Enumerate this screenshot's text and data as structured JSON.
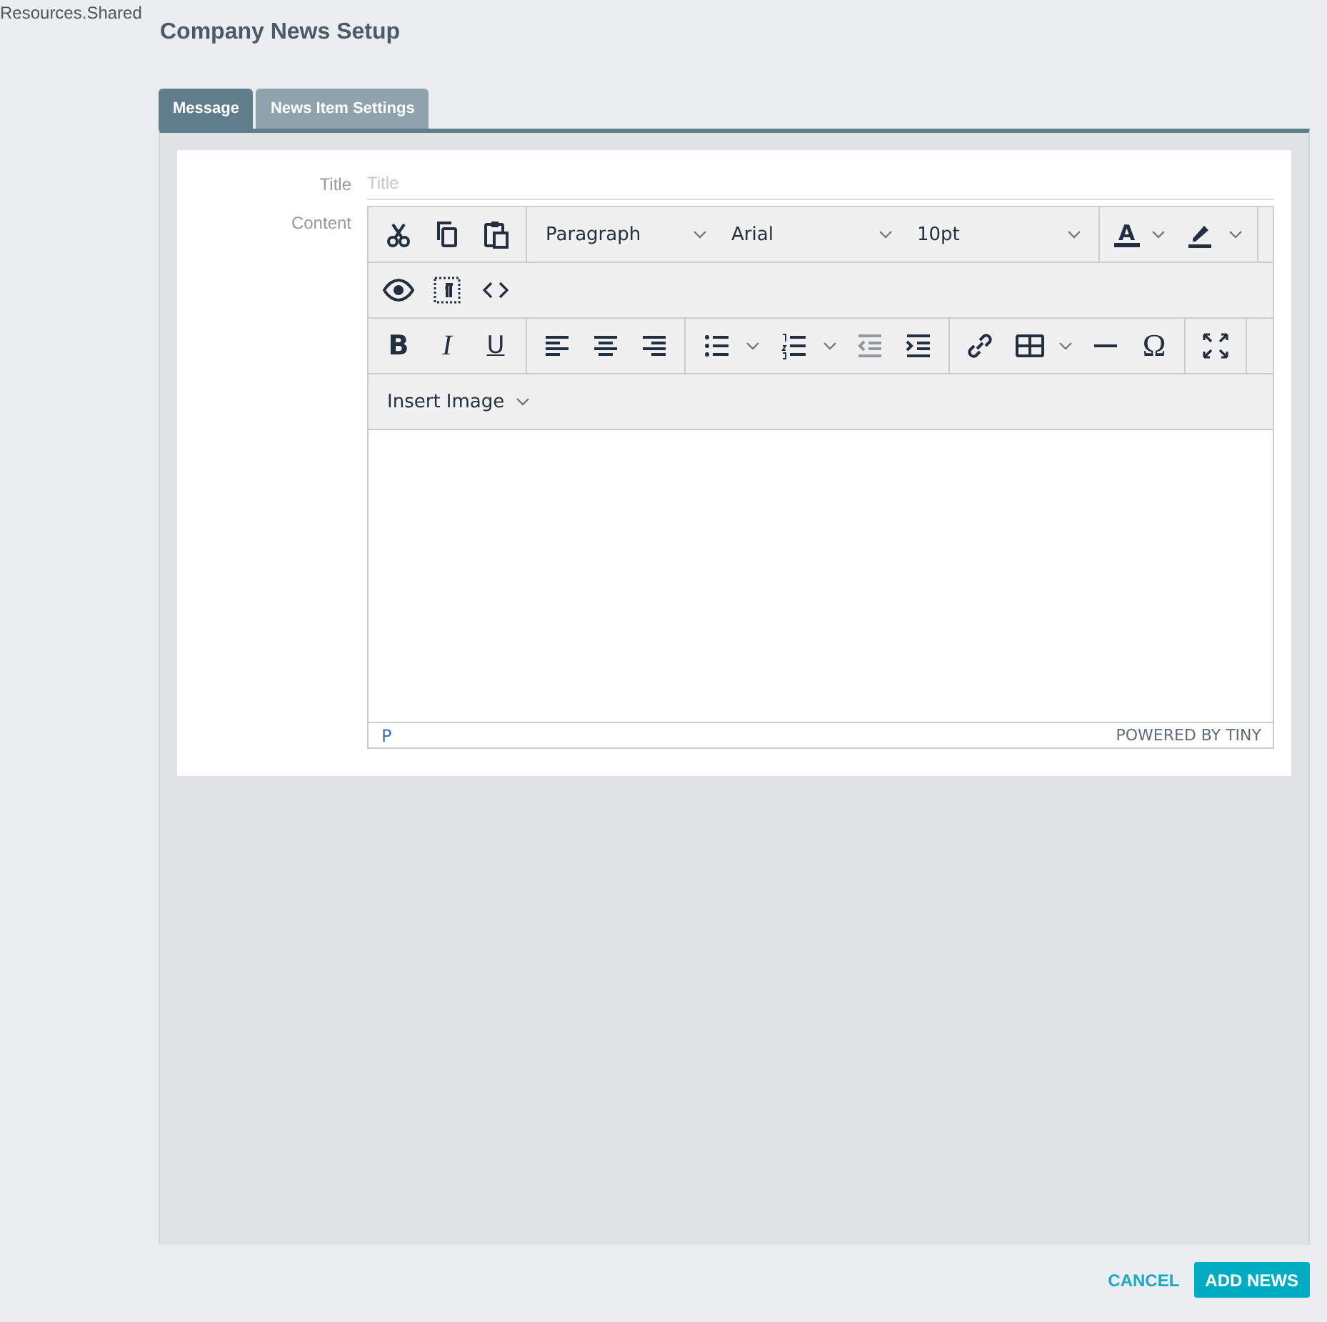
{
  "resource_label": "Resources.Shared",
  "page_title": "Company News Setup",
  "tabs": [
    {
      "label": "Message",
      "selected": true
    },
    {
      "label": "News Item Settings",
      "selected": false
    }
  ],
  "form": {
    "title_label": "Title",
    "title_placeholder": "Title",
    "content_label": "Content"
  },
  "toolbar": [
    [
      [
        {
          "kind": "button",
          "disabled": false
        },
        {
          "kind": "button",
          "disabled": false
        },
        {
          "kind": "button",
          "disabled": false
        }
      ],
      [
        {
          "kind": "select",
          "label": "Paragraph"
        },
        {
          "kind": "select",
          "label": "Arial"
        },
        {
          "kind": "select",
          "label": "10pt"
        }
      ],
      [
        {
          "kind": "split",
          "label": "A",
          "disabled": false
        },
        {
          "kind": "split",
          "disabled": false
        }
      ]
    ],
    [
      [
        {
          "kind": "button",
          "disabled": false
        },
        {
          "kind": "button",
          "disabled": false
        },
        {
          "kind": "button",
          "disabled": false
        }
      ]
    ],
    [
      [
        {
          "kind": "button",
          "label": "B",
          "disabled": false
        },
        {
          "kind": "button",
          "label": "I",
          "disabled": false
        },
        {
          "kind": "button",
          "label": "U",
          "disabled": false
        }
      ],
      [
        {
          "kind": "button",
          "disabled": false
        },
        {
          "kind": "button",
          "disabled": false
        },
        {
          "kind": "button",
          "disabled": false
        }
      ],
      [
        {
          "kind": "split",
          "disabled": false
        },
        {
          "kind": "split",
          "disabled": false
        },
        {
          "kind": "button",
          "disabled": true
        },
        {
          "kind": "button",
          "disabled": false
        }
      ],
      [
        {
          "kind": "button",
          "disabled": false
        },
        {
          "kind": "split",
          "disabled": false
        },
        {
          "kind": "button",
          "disabled": false
        },
        {
          "kind": "button",
          "label": "Ω",
          "disabled": false
        }
      ],
      [
        {
          "kind": "button",
          "disabled": false
        }
      ]
    ],
    [
      [
        {
          "kind": "menu",
          "label": "Insert Image"
        }
      ]
    ]
  ],
  "status_bar": {
    "path": "P",
    "branding": "POWERED BY TINY"
  },
  "buttons": [
    {
      "label": "CANCEL",
      "kind": "link"
    },
    {
      "label": "ADD NEWS",
      "kind": "primary"
    }
  ]
}
